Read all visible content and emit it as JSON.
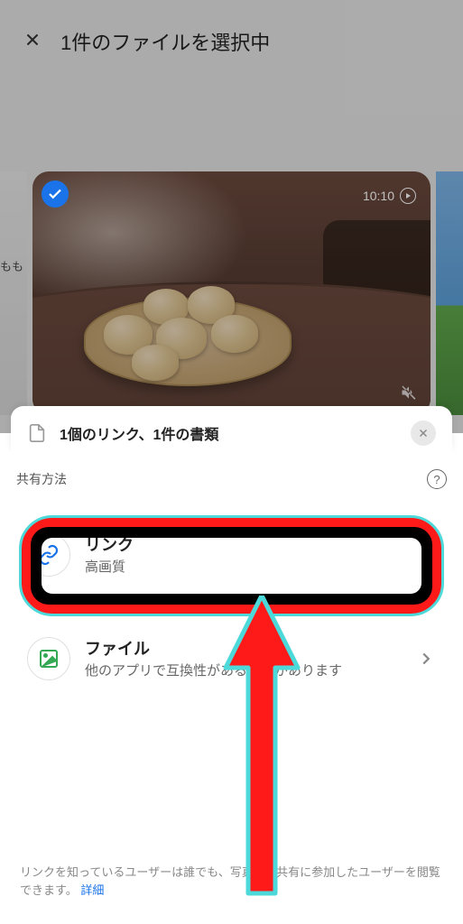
{
  "header": {
    "title": "1件のファイルを選択中"
  },
  "media": {
    "side_label": "もも",
    "video_duration": "10:10"
  },
  "file_card": {
    "title": "1個のリンク、1件の書類"
  },
  "share": {
    "section_label": "共有方法"
  },
  "options": {
    "link": {
      "title": "リンク",
      "subtitle": "高画質"
    },
    "file": {
      "title": "ファイル",
      "subtitle": "他のアプリで互換性がある場合があります"
    }
  },
  "footer": {
    "text": "リンクを知っているユーザーは誰でも、写真と、共有に参加したユーザーを閲覧できます。",
    "link": "詳細"
  }
}
